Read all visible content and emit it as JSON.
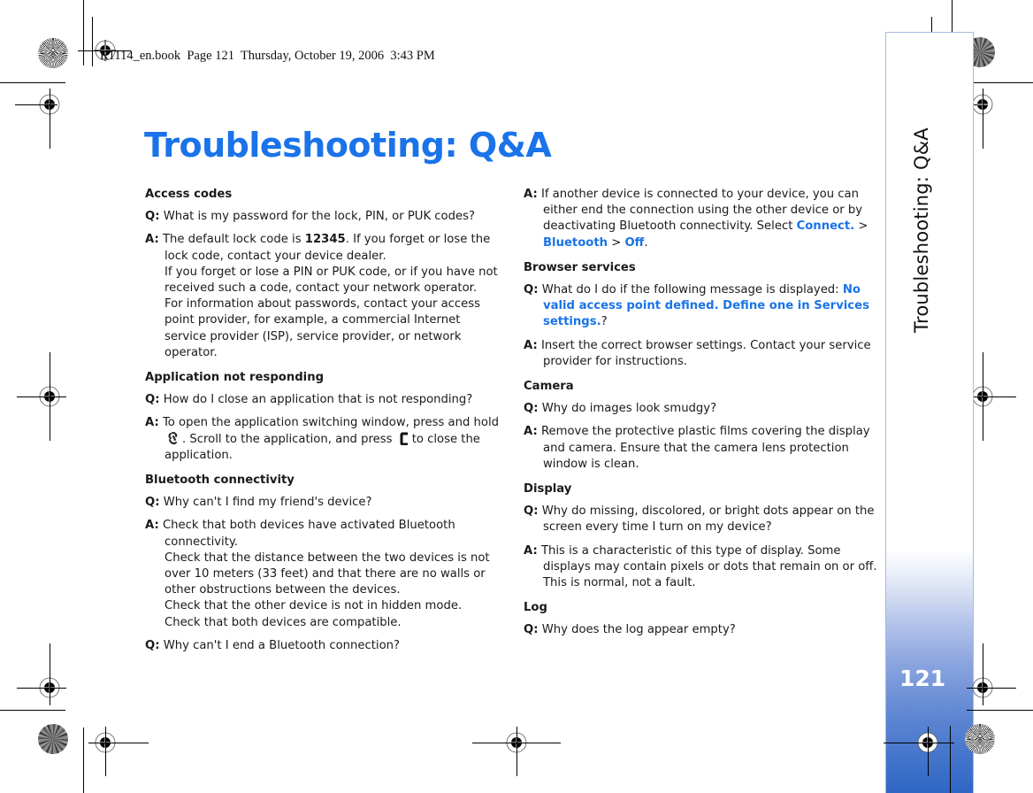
{
  "print_header": "R1114_en.book  Page 121  Thursday, October 19, 2006  3:43 PM",
  "title": "Troubleshooting: Q&A",
  "side_tab": {
    "title": "Troubleshooting: Q&A",
    "page_number": "121"
  },
  "colors": {
    "accent_blue": "#1a73e8",
    "tab_gradient_bottom": "#2e66c4",
    "tab_border": "#a8b8e0"
  },
  "left_column": {
    "access_codes": {
      "heading": "Access codes",
      "q_label": "Q:",
      "q_text": "What is my password for the lock, PIN, or PUK codes?",
      "a_label": "A:",
      "a_pre": "The default lock code is ",
      "a_code": "12345",
      "a_post": ". If you forget or lose the lock code, contact your device dealer.",
      "a_line2": "If you forget or lose a PIN or PUK code, or if you have not received such a code, contact your network operator.",
      "a_line3": "For information about passwords, contact your access point provider, for example, a commercial Internet service provider (ISP), service provider, or network operator."
    },
    "app_not_responding": {
      "heading": "Application not responding",
      "q_label": "Q:",
      "q_text": "How do I close an application that is not responding?",
      "a_label": "A:",
      "a_pre": "To open the application switching window, press and hold",
      "a_mid": ". Scroll to the application, and press",
      "a_post": "to close the application.",
      "menu_key_icon": "menu-key-icon",
      "clear_key_icon": "clear-key-icon"
    },
    "bluetooth": {
      "heading": "Bluetooth connectivity",
      "q1_label": "Q:",
      "q1_text": "Why can't I find my friend's device?",
      "a1_label": "A:",
      "a1_lines": [
        "Check that both devices have activated Bluetooth connectivity.",
        "Check that the distance between the two devices is not over 10 meters (33 feet) and that there are no walls or other obstructions between the devices.",
        "Check that the other device is not in hidden mode.",
        "Check that both devices are compatible."
      ],
      "q2_label": "Q:",
      "q2_text": "Why can't I end a Bluetooth connection?"
    }
  },
  "right_column": {
    "bluetooth_answer": {
      "a_label": "A:",
      "a_pre": "If another device is connected to your device, you can either end the connection using the other device or by deactivating Bluetooth connectivity. Select ",
      "menu_path": [
        "Connect.",
        "Bluetooth",
        "Off"
      ],
      "separator": " > ",
      "a_post": "."
    },
    "browser_services": {
      "heading": "Browser services",
      "q_label": "Q:",
      "q_pre": "What do I do if the following message is displayed: ",
      "q_message": "No valid access point defined. Define one in Services settings.",
      "q_post": "?",
      "a_label": "A:",
      "a_text": "Insert the correct browser settings. Contact your service provider for instructions."
    },
    "camera": {
      "heading": "Camera",
      "q_label": "Q:",
      "q_text": "Why do images look smudgy?",
      "a_label": "A:",
      "a_text": "Remove the protective plastic films covering the display and camera. Ensure that the camera lens protection window is clean."
    },
    "display": {
      "heading": "Display",
      "q_label": "Q:",
      "q_text": "Why do missing, discolored, or bright dots appear on the screen every time I turn on my device?",
      "a_label": "A:",
      "a_text": "This is a characteristic of this type of display. Some displays may contain pixels or dots that remain on or off. This is normal, not a fault."
    },
    "log": {
      "heading": "Log",
      "q_label": "Q:",
      "q_text": "Why does the log appear empty?"
    }
  }
}
